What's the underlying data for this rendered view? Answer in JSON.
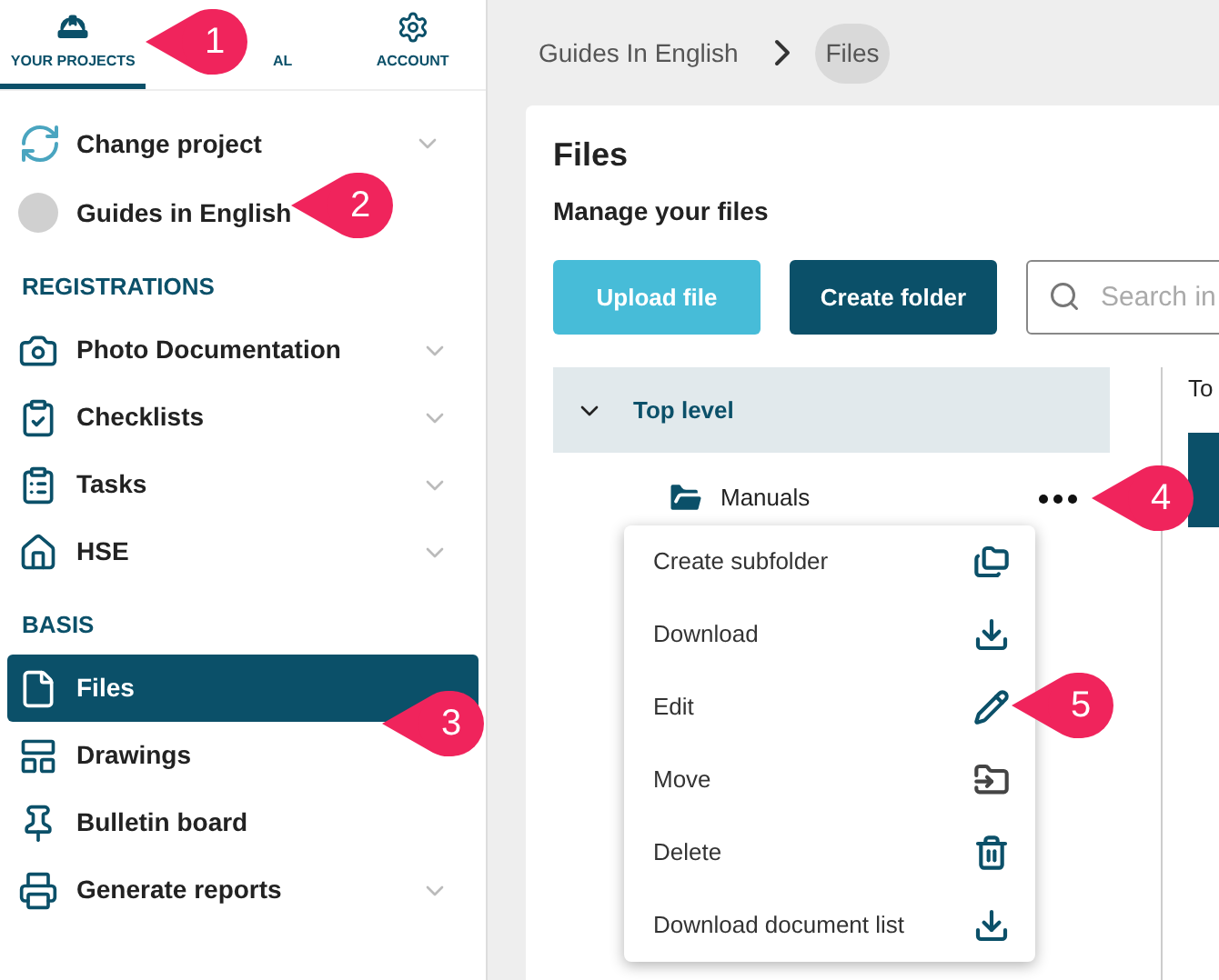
{
  "tabs": [
    {
      "label": "YOUR PROJECTS",
      "selected": true
    },
    {
      "label": "AL",
      "selected": false
    },
    {
      "label": "ACCOUNT",
      "selected": false
    }
  ],
  "project": {
    "change_label": "Change project",
    "current": "Guides in English"
  },
  "sections": [
    {
      "title": "REGISTRATIONS",
      "items": [
        {
          "label": "Photo Documentation",
          "selected": false,
          "expandable": true
        },
        {
          "label": "Checklists",
          "selected": false,
          "expandable": true
        },
        {
          "label": "Tasks",
          "selected": false,
          "expandable": true
        },
        {
          "label": "HSE",
          "selected": false,
          "expandable": true
        }
      ]
    },
    {
      "title": "BASIS",
      "items": [
        {
          "label": "Files",
          "selected": true,
          "expandable": false
        },
        {
          "label": "Drawings",
          "selected": false,
          "expandable": false
        },
        {
          "label": "Bulletin board",
          "selected": false,
          "expandable": false
        },
        {
          "label": "Generate reports",
          "selected": false,
          "expandable": true
        }
      ]
    }
  ],
  "breadcrumb": [
    {
      "label": "Guides In English",
      "selected": false
    },
    {
      "label": "Files",
      "selected": true
    }
  ],
  "panel": {
    "title": "Files",
    "subtitle": "Manage your files",
    "buttons": [
      "Upload file",
      "Create folder"
    ],
    "search": {
      "placeholder": "Search in"
    },
    "tree": {
      "label": "Top level",
      "expanded": true,
      "children": [
        {
          "label": "Manuals"
        }
      ]
    },
    "column_3": {
      "heading": "To"
    }
  },
  "context_menu": [
    "Create subfolder",
    "Download",
    "Edit",
    "Move",
    "Delete",
    "Download document list"
  ],
  "callouts": [
    "1",
    "2",
    "3",
    "4",
    "5"
  ]
}
